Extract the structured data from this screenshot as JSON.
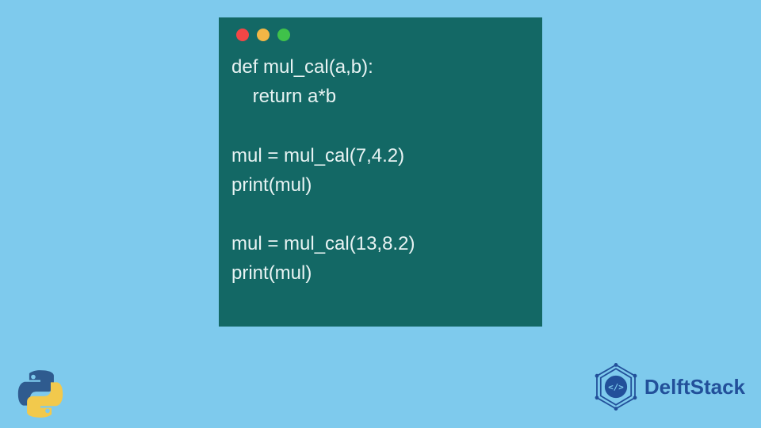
{
  "code": {
    "line1": "def mul_cal(a,b):",
    "line2": "    return a*b",
    "line3": "",
    "line4": "mul = mul_cal(7,4.2)",
    "line5": "print(mul)",
    "line6": "",
    "line7": "mul = mul_cal(13,8.2)",
    "line8": "print(mul)"
  },
  "brand": {
    "name": "DelftStack"
  },
  "colors": {
    "background": "#7ecaed",
    "window": "#136865",
    "code_text": "#e8f3f3",
    "brand_text": "#22509a"
  }
}
